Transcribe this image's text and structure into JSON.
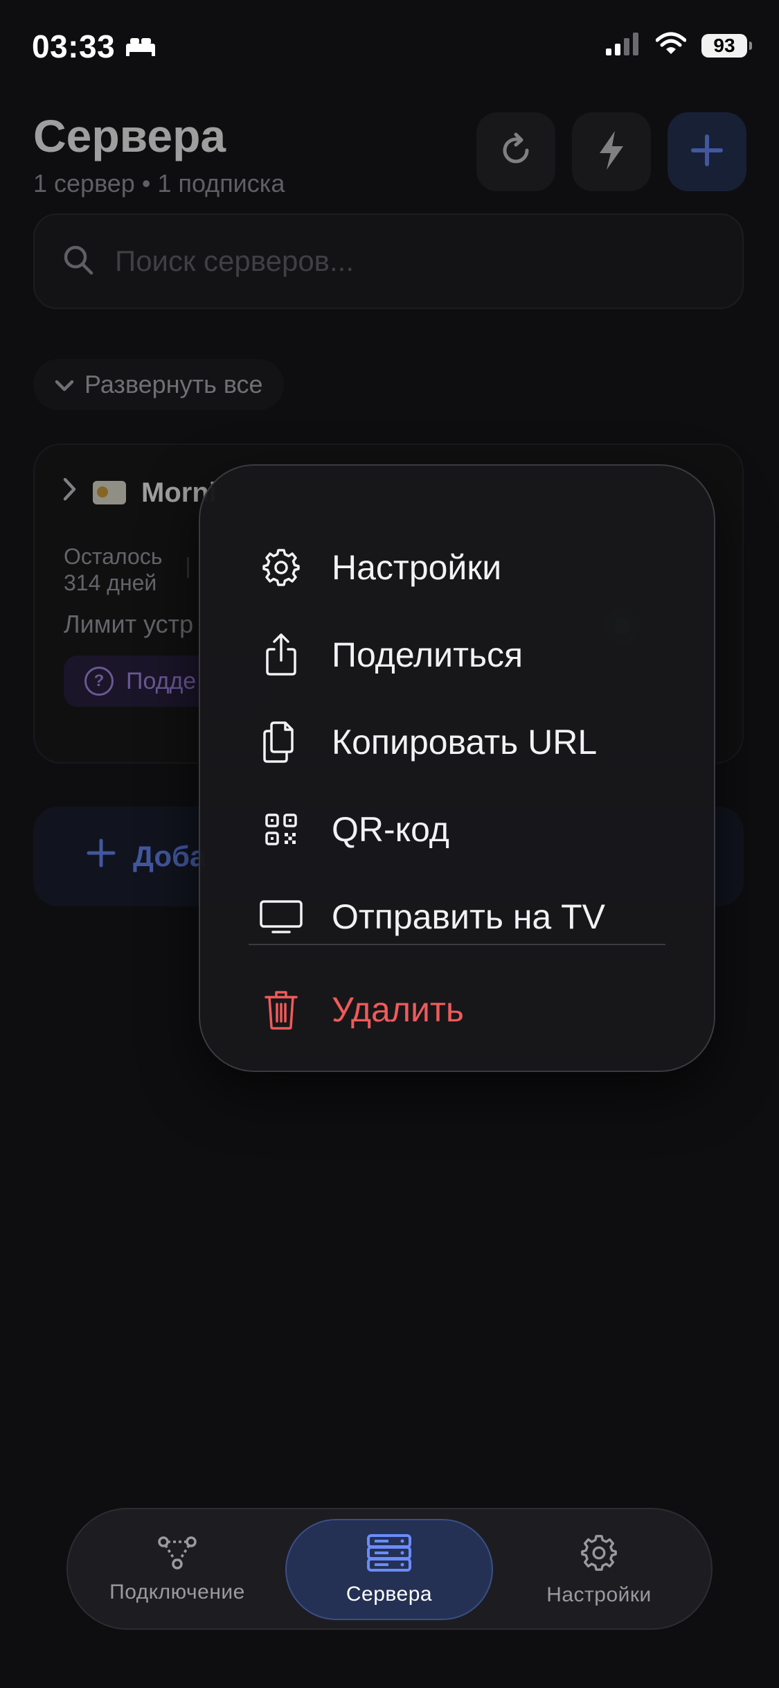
{
  "status_bar": {
    "time": "03:33",
    "battery": "93",
    "icons": [
      "bed-icon",
      "signal-icon",
      "wifi-icon",
      "battery-icon"
    ]
  },
  "header": {
    "title": "Сервера",
    "subtitle": "1 сервер • 1 подписка",
    "buttons": [
      "refresh-icon",
      "lightning-icon",
      "plus-icon"
    ]
  },
  "search": {
    "placeholder": "Поиск серверов..."
  },
  "expand_all_label": "Развернуть все",
  "server_card": {
    "name": "Morni",
    "remaining_label": "Осталось",
    "remaining_value": "314 дней",
    "limit_label": "Лимит устр",
    "support_label": "Подде"
  },
  "add_button_label": "Доба",
  "context_menu": {
    "items": [
      {
        "label": "Настройки",
        "icon": "gear-icon"
      },
      {
        "label": "Поделиться",
        "icon": "share-icon"
      },
      {
        "label": "Копировать URL",
        "icon": "copy-icon"
      },
      {
        "label": "QR-код",
        "icon": "qr-code-icon"
      },
      {
        "label": "Отправить на TV",
        "icon": "tv-icon"
      }
    ],
    "delete": {
      "label": "Удалить",
      "icon": "trash-icon"
    }
  },
  "tabbar": {
    "tabs": [
      {
        "label": "Подключение",
        "icon": "network-icon",
        "active": false
      },
      {
        "label": "Сервера",
        "icon": "servers-icon",
        "active": true
      },
      {
        "label": "Настройки",
        "icon": "gear-icon",
        "active": false
      }
    ]
  },
  "colors": {
    "background": "#0e0e10",
    "accent": "#6b8cff",
    "danger": "#f05a5a",
    "online": "#22c55e"
  }
}
